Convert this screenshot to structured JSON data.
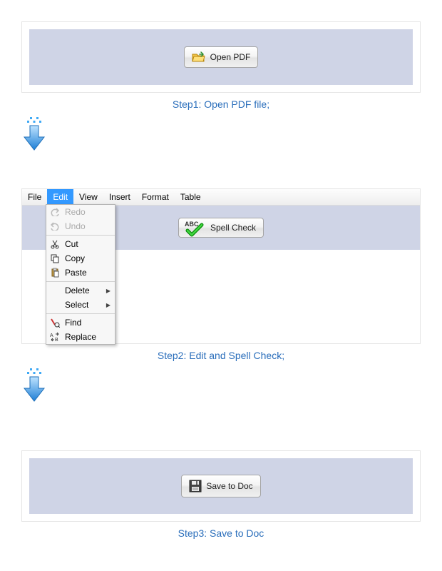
{
  "step1": {
    "button_label": "Open PDF",
    "caption": "Step1: Open PDF file;"
  },
  "step2": {
    "menubar": {
      "file": "File",
      "edit": "Edit",
      "view": "View",
      "insert": "Insert",
      "format": "Format",
      "table": "Table"
    },
    "dropdown": {
      "redo": "Redo",
      "undo": "Undo",
      "cut": "Cut",
      "copy": "Copy",
      "paste": "Paste",
      "delete": "Delete",
      "select": "Select",
      "find": "Find",
      "replace": "Replace"
    },
    "spell_button_label": "Spell Check",
    "caption": "Step2: Edit and Spell Check;"
  },
  "step3": {
    "button_label": "Save to Doc",
    "caption": "Step3: Save to Doc"
  }
}
